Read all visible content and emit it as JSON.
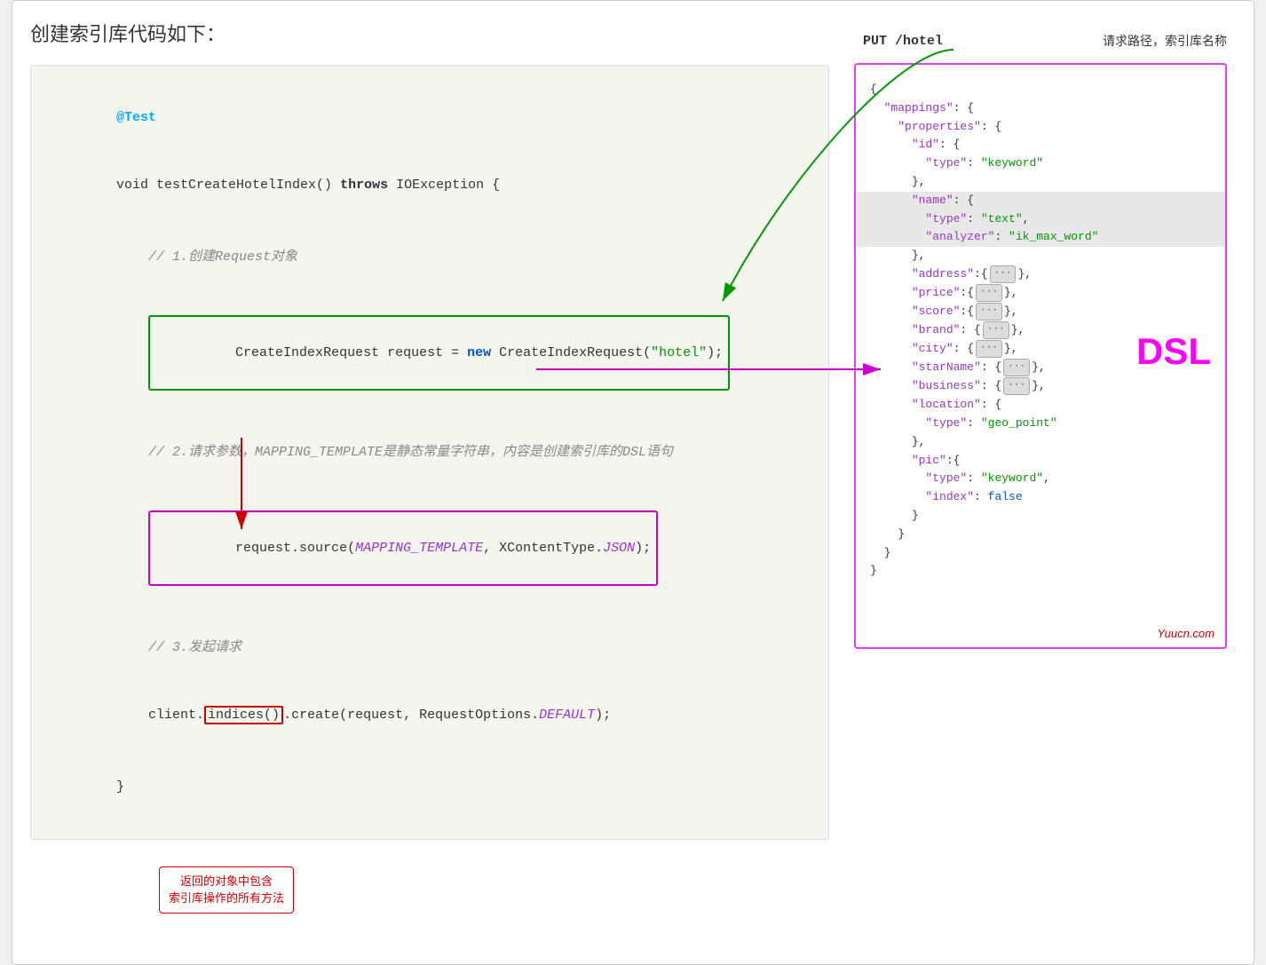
{
  "page": {
    "title": "创建索引库代码如下："
  },
  "code": {
    "annotation": "@Test",
    "method_sig_prefix": "void testCreateHotelIndex() ",
    "throws_keyword": "throws",
    "method_sig_suffix": " IOException {",
    "comment1": "// 1.创建Request对象",
    "line_create_request": "CreateIndexRequest request = new CreateIndexRequest(\"hotel\");",
    "comment2": "// 2.请求参数，MAPPING_TEMPLATE是静态常量字符串，内容是创建索引库的DSL语句",
    "line_source": "request.source(MAPPING_TEMPLATE, XContentType.JSON);",
    "comment3": "// 3.发起请求",
    "line_client": "client.indices().create(request, RequestOptions.DEFAULT);",
    "closing": "}"
  },
  "callout": {
    "line1": "返回的对象中包含",
    "line2": "索引库操作的所有方法"
  },
  "right_panel": {
    "request_path": "PUT /hotel",
    "request_label": "请求路径，索引库名称",
    "dsl_label": "DSL",
    "json_lines": [
      "{",
      "  \"mappings\": {",
      "    \"properties\": {",
      "      \"id\": {",
      "        \"type\": \"keyword\"",
      "      },",
      "      \"name\": {",
      "        \"type\": \"text\",",
      "        \"analyzer\": \"ik_max_word\"",
      "      },",
      "      \"address\":{...},",
      "      \"price\":{...},",
      "      \"score\":{...},",
      "      \"brand\": {...},",
      "      \"city\": {...},",
      "      \"starName\": {...},",
      "      \"business\": {...},",
      "      \"location\": {",
      "        \"type\": \"geo_point\"",
      "      },",
      "      \"pic\":{",
      "        \"type\": \"keyword\",",
      "        \"index\": false",
      "      }",
      "    }",
      "  }",
      "}"
    ]
  },
  "watermark": "Yuucn.com"
}
